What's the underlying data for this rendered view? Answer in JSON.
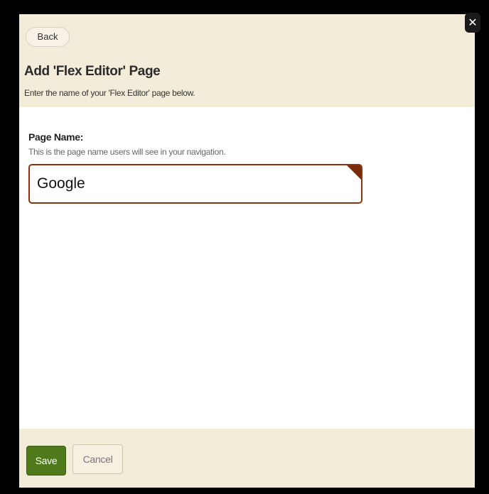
{
  "header": {
    "back_label": "Back",
    "title": "Add 'Flex Editor' Page",
    "subtitle": "Enter the name of your 'Flex Editor' page below."
  },
  "form": {
    "page_name": {
      "label": "Page Name:",
      "help": "This is the page name users will see in your navigation.",
      "value": "Google"
    }
  },
  "footer": {
    "save_label": "Save",
    "cancel_label": "Cancel"
  },
  "colors": {
    "background": "#000000",
    "panel": "#f3ecd9",
    "content": "#ffffff",
    "input_border": "#8a3410",
    "save_button": "#4e7a1b"
  },
  "icons": {
    "close": "close-icon"
  }
}
